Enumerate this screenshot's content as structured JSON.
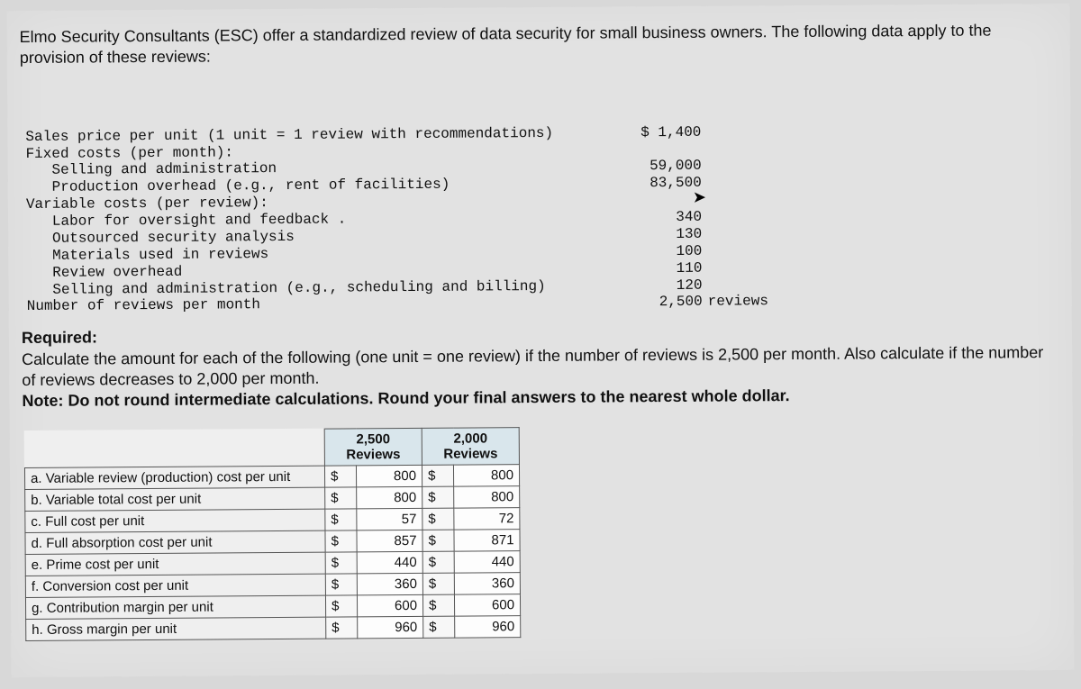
{
  "intro": "Elmo Security Consultants (ESC) offer a standardized review of data security for small business owners. The following data apply to the provision of these reviews:",
  "data_lines": [
    {
      "label": "Sales price per unit (1 unit = 1 review with recommendations)",
      "value": "$ 1,400",
      "indent": 0
    },
    {
      "label": "Fixed costs (per month):",
      "value": "",
      "indent": 0
    },
    {
      "label": "Selling and administration",
      "value": "59,000",
      "indent": 1
    },
    {
      "label": "Production overhead (e.g., rent of facilities)",
      "value": "83,500",
      "indent": 1
    },
    {
      "label": "Variable costs (per review):",
      "value": "",
      "indent": 0
    },
    {
      "label": "Labor for oversight and feedback .",
      "value": "340",
      "indent": 1
    },
    {
      "label": "Outsourced security analysis",
      "value": "130",
      "indent": 1
    },
    {
      "label": "Materials used in reviews",
      "value": "100",
      "indent": 1
    },
    {
      "label": "Review overhead",
      "value": "110",
      "indent": 1
    },
    {
      "label": "Selling and administration (e.g., scheduling and billing)",
      "value": "120",
      "indent": 1
    },
    {
      "label": "Number of reviews per month",
      "value": "2,500",
      "unit": "reviews",
      "indent": 0
    }
  ],
  "required": {
    "title": "Required:",
    "body1": "Calculate the amount for each of the following (one unit = one review) if the number of reviews is 2,500 per month. Also calculate if the number of reviews decreases to 2,000 per month.",
    "note": "Note: Do not round intermediate calculations. Round your final answers to the nearest whole dollar."
  },
  "table": {
    "col1_header": "2,500\nReviews",
    "col2_header": "2,000\nReviews",
    "rows": [
      {
        "label": "a. Variable review (production) cost per unit",
        "v2500": "800",
        "v2000": "800"
      },
      {
        "label": "b. Variable total cost per unit",
        "v2500": "800",
        "v2000": "800"
      },
      {
        "label": "c. Full cost per unit",
        "v2500": "57",
        "v2000": "72"
      },
      {
        "label": "d. Full absorption cost per unit",
        "v2500": "857",
        "v2000": "871"
      },
      {
        "label": "e. Prime cost per unit",
        "v2500": "440",
        "v2000": "440"
      },
      {
        "label": "f. Conversion cost per unit",
        "v2500": "360",
        "v2000": "360"
      },
      {
        "label": "g. Contribution margin per unit",
        "v2500": "600",
        "v2000": "600"
      },
      {
        "label": "h. Gross margin per unit",
        "v2500": "960",
        "v2000": "960"
      }
    ],
    "currency": "$"
  }
}
